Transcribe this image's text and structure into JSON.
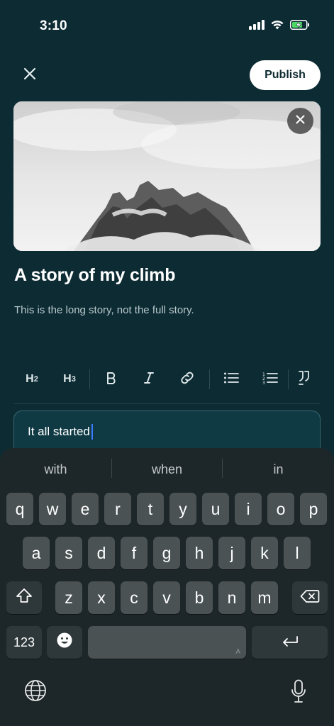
{
  "status": {
    "time": "3:10"
  },
  "header": {
    "publish_label": "Publish"
  },
  "story": {
    "title": "A story of my climb",
    "subtitle": "This is the long story, not the full story."
  },
  "toolbar": {
    "h2": "H",
    "h2_sub": "2",
    "h3": "H",
    "h3_sub": "3"
  },
  "editor": {
    "text": "It all started"
  },
  "keyboard": {
    "suggestions": [
      "with",
      "when",
      "in"
    ],
    "row1": [
      "q",
      "w",
      "e",
      "r",
      "t",
      "y",
      "u",
      "i",
      "o",
      "p"
    ],
    "row2": [
      "a",
      "s",
      "d",
      "f",
      "g",
      "h",
      "j",
      "k",
      "l"
    ],
    "row3": [
      "z",
      "x",
      "c",
      "v",
      "b",
      "n",
      "m"
    ],
    "numbers_label": "123",
    "space_hint": "A"
  },
  "colors": {
    "background": "#0c2b33",
    "publish_button": "#ffffff",
    "editor_border": "#3a6873",
    "caret": "#3d7bff",
    "keyboard": "#1d2628"
  }
}
